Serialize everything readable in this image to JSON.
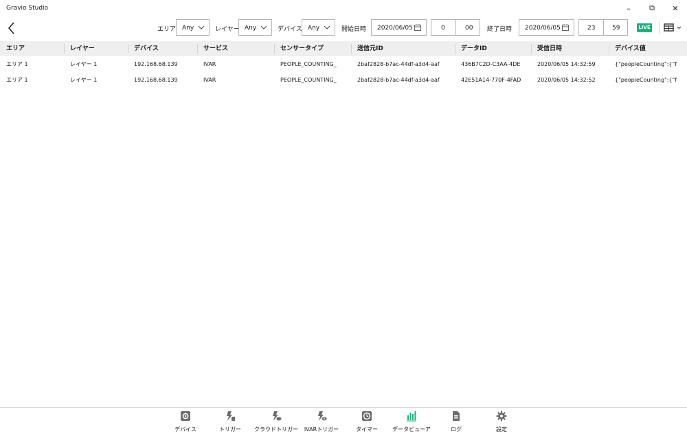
{
  "window": {
    "title": "Gravio Studio",
    "minimize": "–",
    "maximize": "⧉",
    "close": "✕"
  },
  "toolbar": {
    "area_label": "エリア",
    "area_value": "Any",
    "layer_label": "レイヤー",
    "layer_value": "Any",
    "device_label": "デバイス",
    "device_value": "Any",
    "start_label": "開始日時",
    "start_date": "2020/06/05",
    "start_hour": "0",
    "start_minute": "00",
    "end_label": "終了日時",
    "end_date": "2020/06/05",
    "end_hour": "23",
    "end_minute": "59",
    "live_label": "LIVE"
  },
  "table": {
    "columns": [
      "エリア",
      "レイヤー",
      "デバイス",
      "サービス",
      "センサータイプ",
      "送信元ID",
      "データID",
      "受信日時",
      "デバイス値"
    ],
    "rows": [
      [
        "エリア 1",
        "レイヤー 1",
        "192.168.68.139",
        "IVAR",
        "PEOPLE_COUNTING_",
        "2baf2828-b7ac-44df-a3d4-aaf",
        "436B7C2D-C3AA-4DE",
        "2020/06/05 14:32:59",
        "{\"peopleCounting\":{\"f"
      ],
      [
        "エリア 1",
        "レイヤー 1",
        "192.168.68.139",
        "IVAR",
        "PEOPLE_COUNTING_",
        "2baf2828-b7ac-44df-a3d4-aaf",
        "42E51A14-770F-4FAD",
        "2020/06/05 14:32:52",
        "{\"peopleCounting\":{\"f"
      ]
    ]
  },
  "nav": [
    {
      "label": "デバイス",
      "icon": "device-icon"
    },
    {
      "label": "トリガー",
      "icon": "trigger-icon"
    },
    {
      "label": "クラウドトリガー",
      "icon": "cloud-trigger-icon"
    },
    {
      "label": "IVARトリガー",
      "icon": "ivar-trigger-icon"
    },
    {
      "label": "タイマー",
      "icon": "timer-icon"
    },
    {
      "label": "データビューア",
      "icon": "data-viewer-icon"
    },
    {
      "label": "ログ",
      "icon": "log-icon"
    },
    {
      "label": "設定",
      "icon": "settings-icon"
    }
  ],
  "colors": {
    "accent": "#1fb07b",
    "icon_gray": "#6b6b6b",
    "header_bg": "#efefef"
  }
}
